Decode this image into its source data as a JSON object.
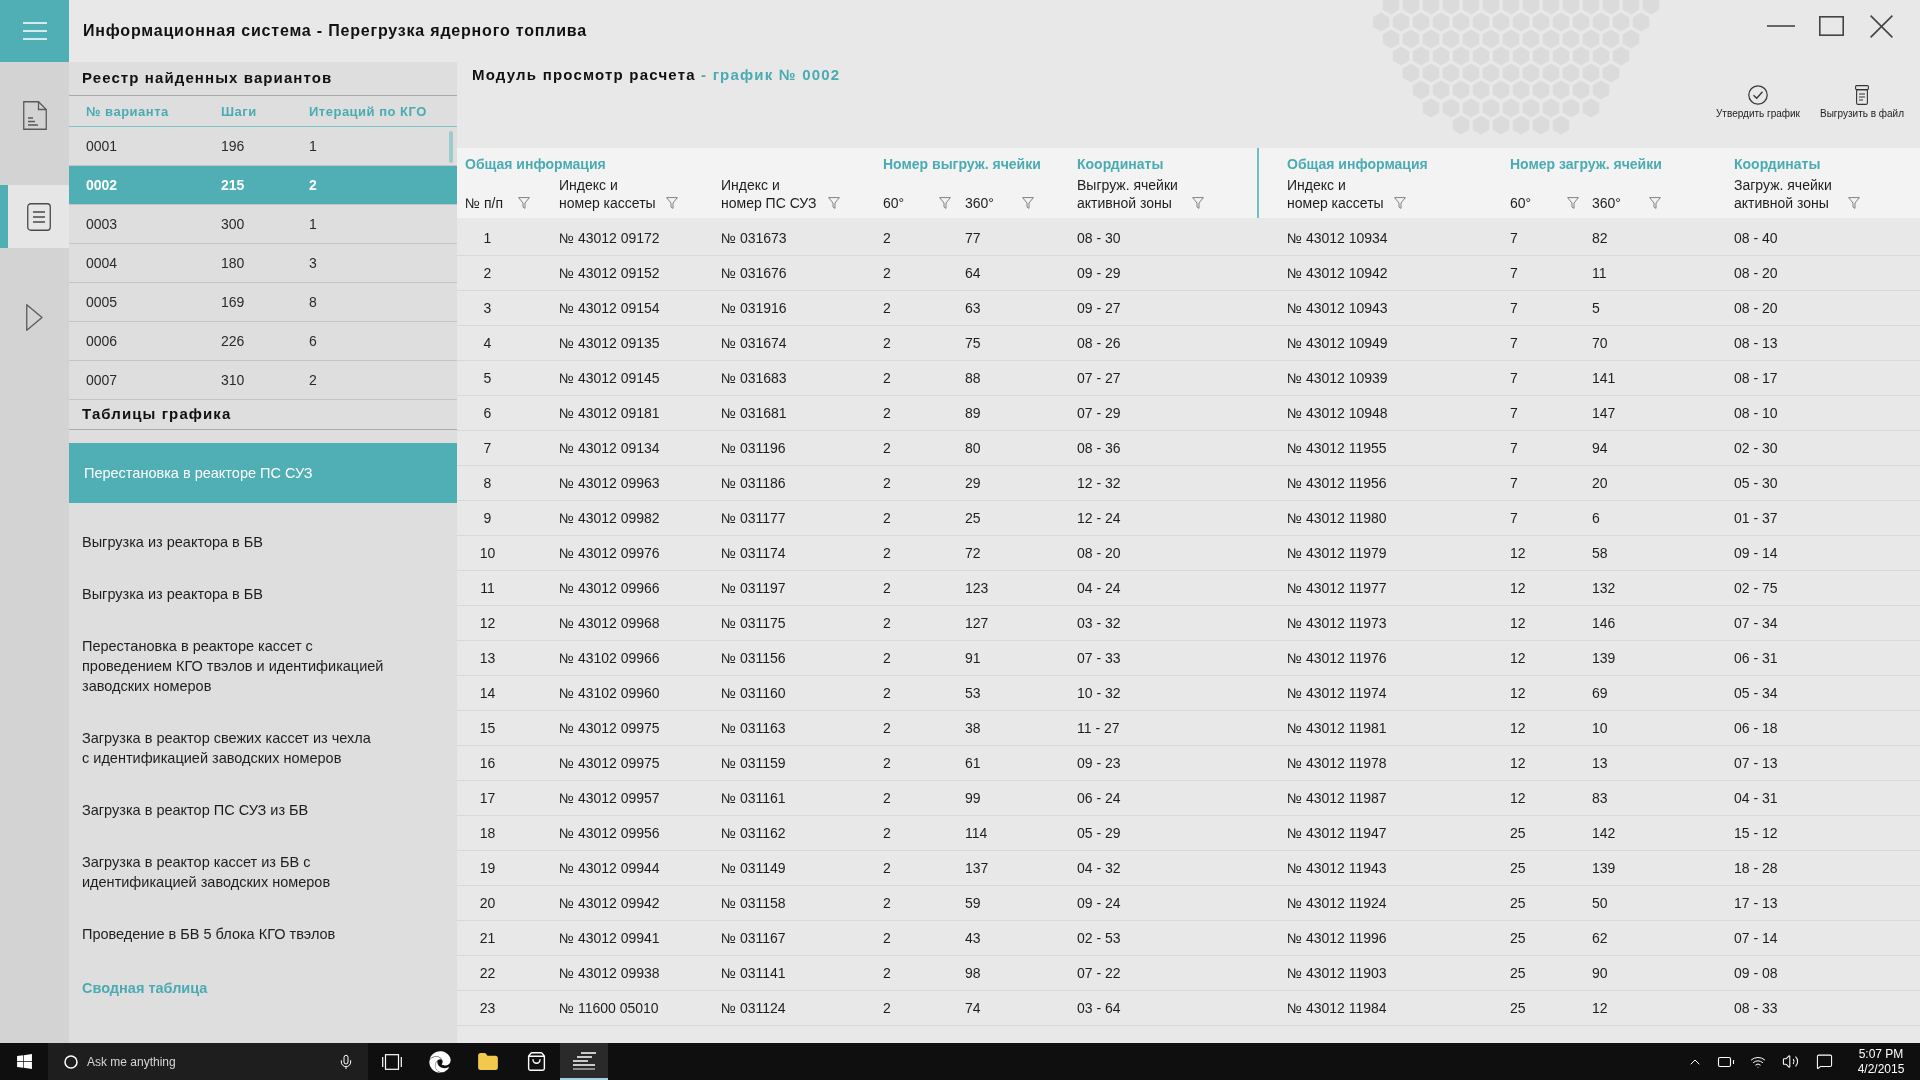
{
  "window": {
    "title": "Информационная система - Перегрузка ядерного топлива"
  },
  "nav_rail": [
    {
      "kind": "document",
      "selected": false
    },
    {
      "kind": "list",
      "selected": true
    },
    {
      "kind": "play",
      "selected": false
    }
  ],
  "registry": {
    "title": "Реестр найденных вариантов",
    "columns": [
      "№ варианта",
      "Шаги",
      "Итераций по КГО"
    ],
    "rows": [
      {
        "cells": [
          "0001",
          "196",
          "1"
        ],
        "selected": false
      },
      {
        "cells": [
          "0002",
          "215",
          "2"
        ],
        "selected": true
      },
      {
        "cells": [
          "0003",
          "300",
          "1"
        ],
        "selected": false
      },
      {
        "cells": [
          "0004",
          "180",
          "3"
        ],
        "selected": false
      },
      {
        "cells": [
          "0005",
          "169",
          "8"
        ],
        "selected": false
      },
      {
        "cells": [
          "0006",
          "226",
          "6"
        ],
        "selected": false
      },
      {
        "cells": [
          "0007",
          "310",
          "2"
        ],
        "selected": false
      }
    ]
  },
  "schedule_tables": {
    "title": "Таблицы графика",
    "items": [
      {
        "label": "Перестановка в реакторе ПС СУЗ",
        "selected": true
      },
      {
        "label": "Выгрузка из реактора в БВ",
        "selected": false
      },
      {
        "label": "Выгрузка из реактора в БВ",
        "selected": false
      },
      {
        "label": "Перестановка в реакторе кассет с\nпроведением КГО твэлов и идентификацией\nзаводских номеров",
        "selected": false
      },
      {
        "label": "Загрузка в реактор свежих кассет из чехла\nс идентификацией заводских номеров",
        "selected": false
      },
      {
        "label": "Загрузка в реактор ПС СУЗ из БВ",
        "selected": false
      },
      {
        "label": "Загрузка в реактор кассет из БВ с\nидентификацией заводских номеров",
        "selected": false
      },
      {
        "label": "Проведение в БВ 5 блока КГО твэлов",
        "selected": false
      }
    ],
    "summary_link": "Сводная таблица"
  },
  "module": {
    "title": "Модуль просмотр расчета",
    "schedule_label": "- график № 0002"
  },
  "toolbar": [
    {
      "kind": "approve",
      "label": "Утвердить график"
    },
    {
      "kind": "export",
      "label": "Выгрузить в файл"
    }
  ],
  "table": {
    "sections": [
      {
        "groups": [
          {
            "title": "Общая информация",
            "columns": [
              {
                "label": "№ п/п",
                "filter": true
              },
              {
                "label": "Индекс и\nномер кассеты",
                "filter": true
              },
              {
                "label": "Индекс и\nномер ПС СУЗ",
                "filter": true
              }
            ]
          },
          {
            "title": "Номер выгруж. ячейки",
            "columns": [
              {
                "label": "60°",
                "filter": true
              },
              {
                "label": "360°",
                "filter": true
              }
            ]
          },
          {
            "title": "Координаты",
            "columns": [
              {
                "label": "Выгруж. ячейки\nактивной зоны",
                "filter": true
              }
            ]
          }
        ]
      },
      {
        "groups": [
          {
            "title": "Общая информация",
            "columns": [
              {
                "label": "Индекс и\nномер кассеты",
                "filter": true
              }
            ]
          },
          {
            "title": "Номер загруж. ячейки",
            "columns": [
              {
                "label": "60°",
                "filter": true
              },
              {
                "label": "360°",
                "filter": true
              }
            ]
          },
          {
            "title": "Координаты",
            "columns": [
              {
                "label": "Загруж. ячейки\nактивной зоны",
                "filter": true
              }
            ]
          }
        ]
      }
    ],
    "rows": [
      [
        "1",
        "№ 43012 09172",
        "№ 031673",
        "2",
        "77",
        "08 - 30",
        "№ 43012 10934",
        "7",
        "82",
        "08 - 40"
      ],
      [
        "2",
        "№ 43012 09152",
        "№ 031676",
        "2",
        "64",
        "09 - 29",
        "№ 43012 10942",
        "7",
        "11",
        "08 - 20"
      ],
      [
        "3",
        "№ 43012 09154",
        "№ 031916",
        "2",
        "63",
        "09 - 27",
        "№ 43012 10943",
        "7",
        "5",
        "08 - 20"
      ],
      [
        "4",
        "№ 43012 09135",
        "№ 031674",
        "2",
        "75",
        "08 - 26",
        "№ 43012 10949",
        "7",
        "70",
        "08 - 13"
      ],
      [
        "5",
        "№ 43012 09145",
        "№ 031683",
        "2",
        "88",
        "07 - 27",
        "№ 43012 10939",
        "7",
        "141",
        "08 - 17"
      ],
      [
        "6",
        "№ 43012 09181",
        "№ 031681",
        "2",
        "89",
        "07 - 29",
        "№ 43012 10948",
        "7",
        "147",
        "08 - 10"
      ],
      [
        "7",
        "№ 43012 09134",
        "№ 031196",
        "2",
        "80",
        "08 - 36",
        "№ 43012 11955",
        "7",
        "94",
        "02 - 30"
      ],
      [
        "8",
        "№ 43012 09963",
        "№ 031186",
        "2",
        "29",
        "12 - 32",
        "№ 43012 11956",
        "7",
        "20",
        "05 - 30"
      ],
      [
        "9",
        "№ 43012 09982",
        "№ 031177",
        "2",
        "25",
        "12 - 24",
        "№ 43012 11980",
        "7",
        "6",
        "01 - 37"
      ],
      [
        "10",
        "№ 43012 09976",
        "№ 031174",
        "2",
        "72",
        "08 - 20",
        "№ 43012 11979",
        "12",
        "58",
        "09 - 14"
      ],
      [
        "11",
        "№ 43012 09966",
        "№ 031197",
        "2",
        "123",
        "04 - 24",
        "№ 43012 11977",
        "12",
        "132",
        "02 - 75"
      ],
      [
        "12",
        "№ 43012 09968",
        "№ 031175",
        "2",
        "127",
        "03 - 32",
        "№ 43012 11973",
        "12",
        "146",
        "07 - 34"
      ],
      [
        "13",
        "№ 43102 09966",
        "№ 031156",
        "2",
        "91",
        "07 - 33",
        "№ 43012 11976",
        "12",
        "139",
        "06 - 31"
      ],
      [
        "14",
        "№ 43102 09960",
        "№ 031160",
        "2",
        "53",
        "10 - 32",
        "№ 43012 11974",
        "12",
        "69",
        "05 - 34"
      ],
      [
        "15",
        "№ 43012 09975",
        "№ 031163",
        "2",
        "38",
        "11 - 27",
        "№ 43012 11981",
        "12",
        "10",
        "06 - 18"
      ],
      [
        "16",
        "№ 43012 09975",
        "№ 031159",
        "2",
        "61",
        "09 - 23",
        "№ 43012 11978",
        "12",
        "13",
        "07 - 13"
      ],
      [
        "17",
        "№ 43012 09957",
        "№ 031161",
        "2",
        "99",
        "06 - 24",
        "№ 43012 11987",
        "12",
        "83",
        "04 - 31"
      ],
      [
        "18",
        "№ 43012 09956",
        "№ 031162",
        "2",
        "114",
        "05 - 29",
        "№ 43012 11947",
        "25",
        "142",
        "15 - 12"
      ],
      [
        "19",
        "№ 43012 09944",
        "№ 031149",
        "2",
        "137",
        "04 - 32",
        "№ 43012 11943",
        "25",
        "139",
        "18 - 28"
      ],
      [
        "20",
        "№ 43012 09942",
        "№ 031158",
        "2",
        "59",
        "09 - 24",
        "№ 43012 11924",
        "25",
        "50",
        "17 - 13"
      ],
      [
        "21",
        "№ 43012 09941",
        "№ 031167",
        "2",
        "43",
        "02 - 53",
        "№ 43012 11996",
        "25",
        "62",
        "07 - 14"
      ],
      [
        "22",
        "№ 43012 09938",
        "№ 031141",
        "2",
        "98",
        "07 - 22",
        "№ 43012 11903",
        "25",
        "90",
        "09 - 08"
      ],
      [
        "23",
        "№ 11600 05010",
        "№ 031124",
        "2",
        "74",
        "03 - 64",
        "№ 43012 11984",
        "25",
        "12",
        "08 - 33"
      ]
    ]
  },
  "taskbar": {
    "search": {
      "placeholder": "Ask me anything"
    },
    "apps": [
      {
        "kind": "task_view",
        "selected": false
      },
      {
        "kind": "browser",
        "selected": false
      },
      {
        "kind": "folder",
        "selected": false
      },
      {
        "kind": "store",
        "selected": false
      },
      {
        "kind": "app",
        "selected": true
      }
    ],
    "time": "5:07 PM",
    "date": "4/2/2015"
  }
}
